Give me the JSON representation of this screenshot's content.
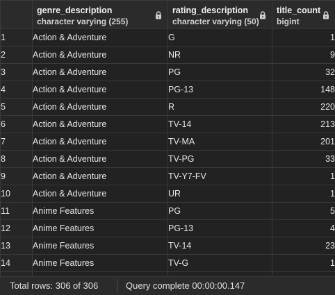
{
  "columns": [
    {
      "name": "genre_description",
      "type": "character varying (255)"
    },
    {
      "name": "rating_description",
      "type": "character varying (50)"
    },
    {
      "name": "title_count",
      "type": "bigint"
    }
  ],
  "rows": [
    [
      "1",
      "Action & Adventure",
      "G",
      "1"
    ],
    [
      "2",
      "Action & Adventure",
      "NR",
      "9"
    ],
    [
      "3",
      "Action & Adventure",
      "PG",
      "32"
    ],
    [
      "4",
      "Action & Adventure",
      "PG-13",
      "148"
    ],
    [
      "5",
      "Action & Adventure",
      "R",
      "220"
    ],
    [
      "6",
      "Action & Adventure",
      "TV-14",
      "213"
    ],
    [
      "7",
      "Action & Adventure",
      "TV-MA",
      "201"
    ],
    [
      "8",
      "Action & Adventure",
      "TV-PG",
      "33"
    ],
    [
      "9",
      "Action & Adventure",
      "TV-Y7-FV",
      "1"
    ],
    [
      "10",
      "Action & Adventure",
      "UR",
      "1"
    ],
    [
      "11",
      "Anime Features",
      "PG",
      "5"
    ],
    [
      "12",
      "Anime Features",
      "PG-13",
      "4"
    ],
    [
      "13",
      "Anime Features",
      "TV-14",
      "23"
    ],
    [
      "14",
      "Anime Features",
      "TV-G",
      "1"
    ]
  ],
  "status": {
    "total_rows": "Total rows: 306 of 306",
    "query_status": "Query complete 00:00:00.147"
  },
  "icons": {
    "column_lock": "lock-icon"
  }
}
